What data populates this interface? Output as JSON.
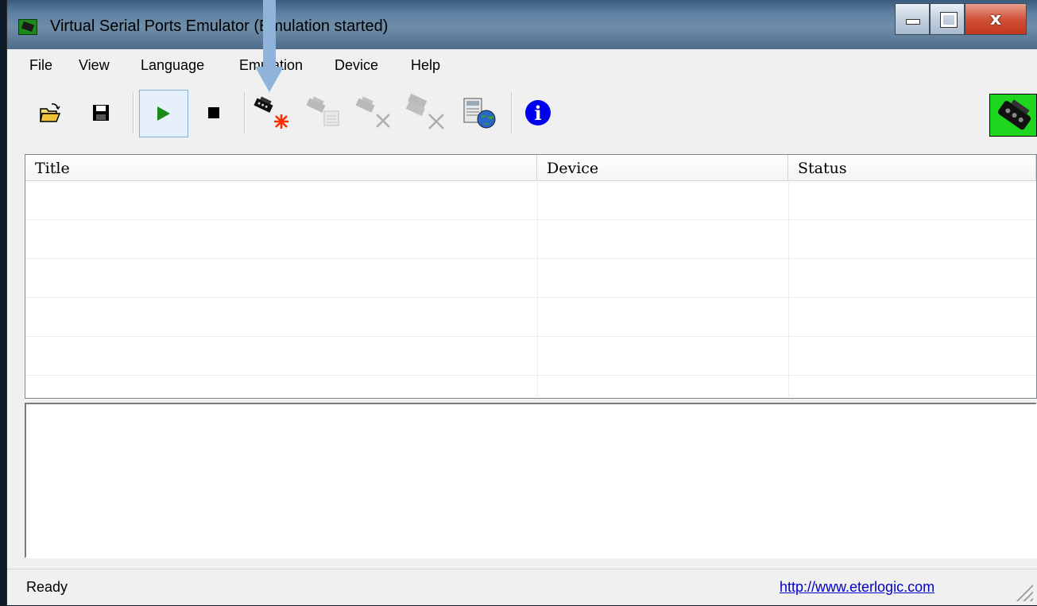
{
  "window": {
    "title": "Virtual Serial Ports Emulator (Emulation started)",
    "buttons": {
      "minimize": "",
      "maximize": "",
      "close": "x"
    }
  },
  "menu": {
    "items": [
      "File",
      "View",
      "Language",
      "Emulation",
      "Device",
      "Help"
    ]
  },
  "toolbar": {
    "buttons": [
      {
        "name": "open-icon"
      },
      {
        "name": "save-icon"
      },
      {
        "name": "play-icon",
        "active": true
      },
      {
        "name": "stop-icon"
      },
      {
        "name": "create-device-icon"
      },
      {
        "name": "edit-device-icon",
        "disabled": true
      },
      {
        "name": "delete-device-icon",
        "disabled": true
      },
      {
        "name": "delete-all-devices-icon",
        "disabled": true
      },
      {
        "name": "settings-icon"
      },
      {
        "name": "info-icon"
      }
    ],
    "info_glyph": "i"
  },
  "list": {
    "columns": [
      "Title",
      "Device",
      "Status"
    ],
    "rows": []
  },
  "status": {
    "text": "Ready",
    "link": "http://www.eterlogic.com"
  },
  "colors": {
    "play": "#1a8a1a",
    "create_star": "#ff2a00",
    "info": "#0000ee",
    "link": "#0000cc",
    "annotation_arrow": "#8fb3d9"
  }
}
